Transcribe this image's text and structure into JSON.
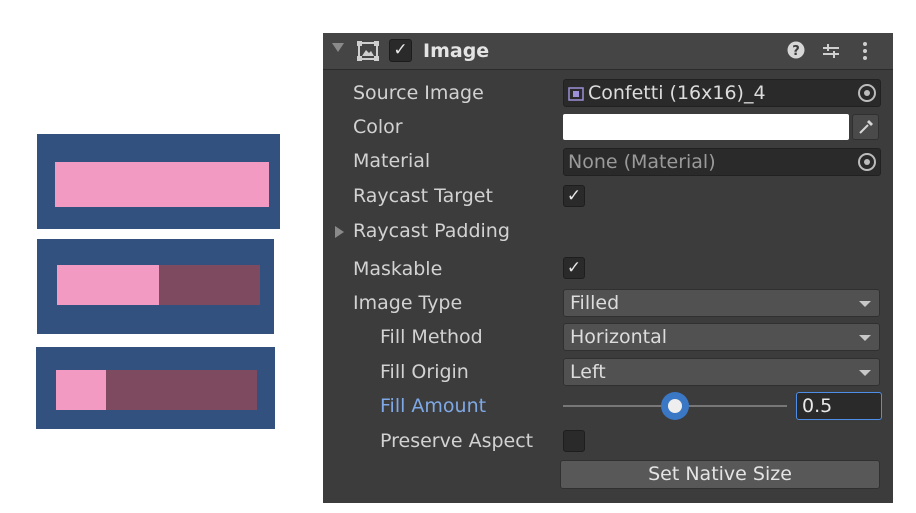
{
  "previews": [
    {
      "fill_amount": 1.0
    },
    {
      "fill_amount": 0.5
    },
    {
      "fill_amount": 0.25
    }
  ],
  "component": {
    "title": "Image",
    "enabled": true,
    "help_icon": "help-icon",
    "presets_icon": "presets-icon",
    "menu_icon": "kebab-menu-icon"
  },
  "properties": {
    "source_image": {
      "label": "Source Image",
      "value": "Confetti (16x16)_4"
    },
    "color": {
      "label": "Color",
      "value": "#ffffff"
    },
    "material": {
      "label": "Material",
      "value": "None (Material)"
    },
    "raycast_target": {
      "label": "Raycast Target",
      "checked": true
    },
    "raycast_padding": {
      "label": "Raycast Padding"
    },
    "maskable": {
      "label": "Maskable",
      "checked": true
    },
    "image_type": {
      "label": "Image Type",
      "value": "Filled"
    },
    "fill_method": {
      "label": "Fill Method",
      "value": "Horizontal"
    },
    "fill_origin": {
      "label": "Fill Origin",
      "value": "Left"
    },
    "fill_amount": {
      "label": "Fill Amount",
      "value": "0.5",
      "fraction": 0.5
    },
    "preserve_aspect": {
      "label": "Preserve Aspect",
      "checked": false
    }
  },
  "set_native_size_label": "Set Native Size",
  "colors": {
    "panel": "#3c3c3c",
    "accent_label": "#7fa8e6",
    "preview_bg": "#33517f",
    "fill": "#f39ac2",
    "track": "#7d4a5f"
  }
}
